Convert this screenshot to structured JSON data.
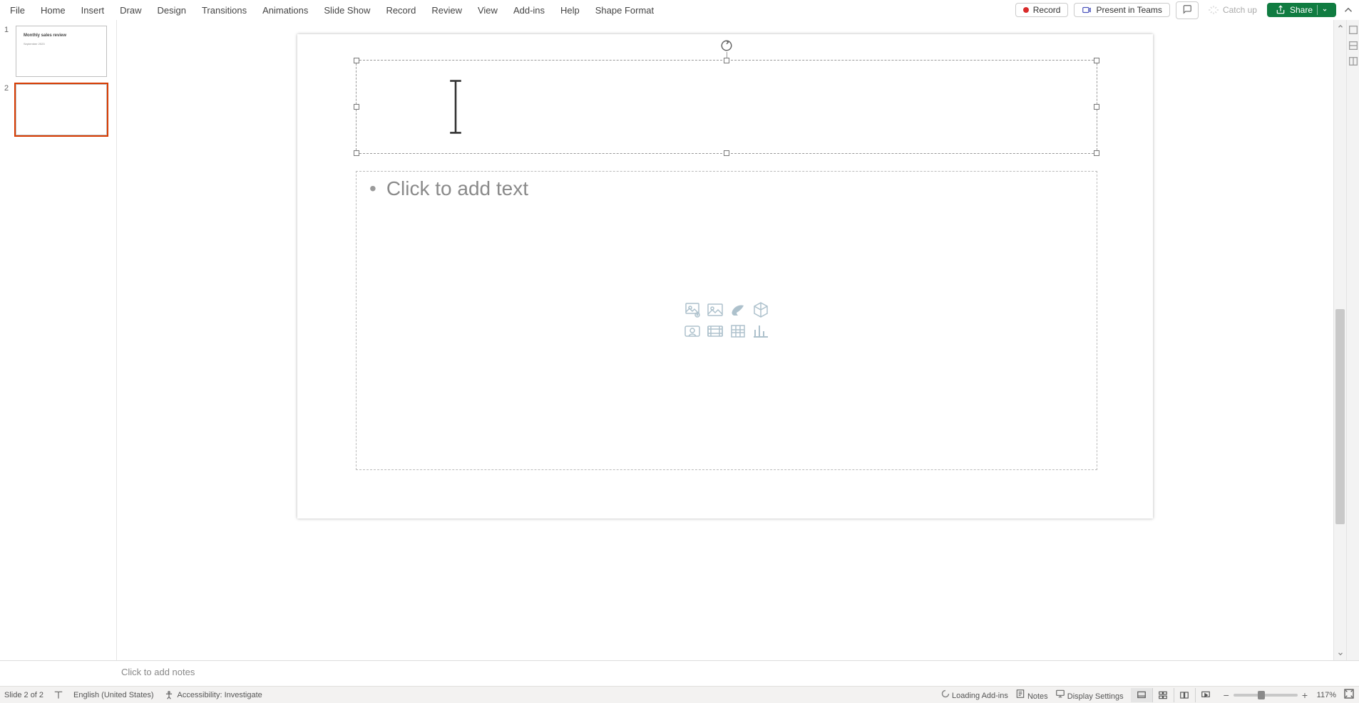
{
  "menu": {
    "items": [
      "File",
      "Home",
      "Insert",
      "Draw",
      "Design",
      "Transitions",
      "Animations",
      "Slide Show",
      "Record",
      "Review",
      "View",
      "Add-ins",
      "Help",
      "Shape Format"
    ]
  },
  "topbar": {
    "record": "Record",
    "present": "Present in Teams",
    "catch_up": "Catch up",
    "share": "Share"
  },
  "slides": {
    "items": [
      {
        "number": "1",
        "title": "Monthly sales review",
        "subtitle": "September 2023",
        "selected": false
      },
      {
        "number": "2",
        "title": "",
        "subtitle": "",
        "selected": true
      }
    ]
  },
  "editor": {
    "content_prompt": "Click to add text"
  },
  "notes": {
    "placeholder": "Click to add notes"
  },
  "status": {
    "slide_counter": "Slide 2 of 2",
    "language": "English (United States)",
    "accessibility": "Accessibility: Investigate",
    "loading": "Loading Add-ins",
    "notes_btn": "Notes",
    "display_settings": "Display Settings",
    "zoom_pct": "117%"
  }
}
